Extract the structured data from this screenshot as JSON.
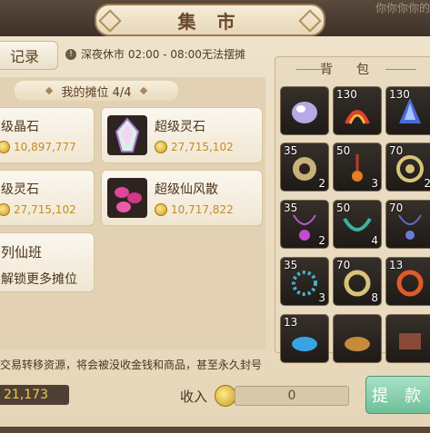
{
  "window": {
    "title": "集 市",
    "top_right_text": "你你你你的"
  },
  "record_button": "记录",
  "notice": "深夜休市 02:00 - 08:00无法摆摊",
  "stall": {
    "header": "我的摊位 4/4",
    "slots": [
      {
        "name": "级晶石",
        "price": "10,897,777"
      },
      {
        "name": "超级灵石",
        "price": "27,715,102"
      },
      {
        "name": "级灵石",
        "price": "27,715,102"
      },
      {
        "name": "超级仙风散",
        "price": "10,717,822"
      }
    ],
    "locked": {
      "title": "列仙班",
      "desc": "解锁更多摊位"
    }
  },
  "bag": {
    "title": "背包",
    "items": [
      {
        "lvl": "",
        "cnt": ""
      },
      {
        "lvl": "130",
        "cnt": ""
      },
      {
        "lvl": "130",
        "cnt": ""
      },
      {
        "lvl": "35",
        "cnt": "2"
      },
      {
        "lvl": "50",
        "cnt": "3"
      },
      {
        "lvl": "70",
        "cnt": "2"
      },
      {
        "lvl": "35",
        "cnt": "2"
      },
      {
        "lvl": "50",
        "cnt": "4"
      },
      {
        "lvl": "70",
        "cnt": ""
      },
      {
        "lvl": "35",
        "cnt": "3"
      },
      {
        "lvl": "70",
        "cnt": "8"
      },
      {
        "lvl": "13",
        "cnt": ""
      },
      {
        "lvl": "13",
        "cnt": ""
      },
      {
        "lvl": "",
        "cnt": ""
      },
      {
        "lvl": "",
        "cnt": ""
      }
    ]
  },
  "warning": "交易转移资源，将会被没收金钱和商品，甚至永久封号",
  "money": "21,173",
  "income": {
    "label": "收入",
    "value": "0"
  },
  "withdraw_button": "提款",
  "colors": {
    "accent_green": "#6fbf98",
    "gold": "#c48d1e"
  }
}
